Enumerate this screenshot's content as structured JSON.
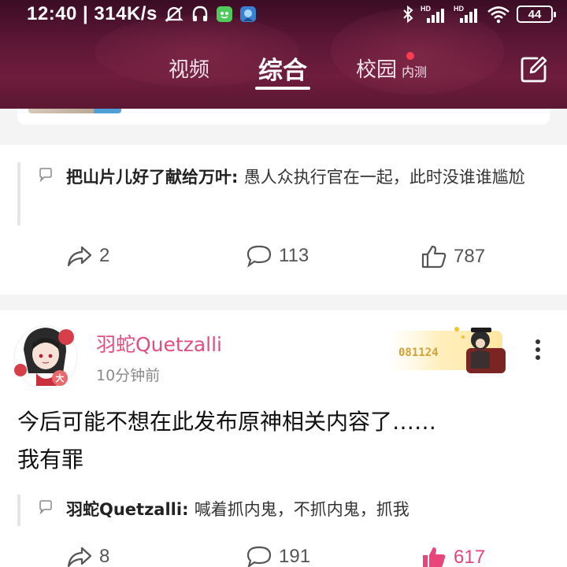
{
  "status_bar": {
    "time_speed": "12:40 | 314K/s",
    "battery": "44",
    "hd_label": "HD"
  },
  "nav": {
    "tabs": [
      "视频",
      "综合",
      "校园"
    ],
    "active_tab": "综合",
    "campus_badge": "内测"
  },
  "posts": [
    {
      "top_comment": {
        "author": "把山片儿好了献给万叶",
        "text": "愚人众执行官在一起，此时没谁谁尴尬"
      },
      "actions": {
        "shares": "2",
        "comments": "113",
        "likes": "787",
        "liked": false
      }
    },
    {
      "username": "羽蛇Quetzalli",
      "time": "10分钟前",
      "badge_number": "081124",
      "avatar_badge": "大",
      "body_line1": "今后可能不想在此发布原神相关内容了……",
      "body_line2": "我有罪",
      "top_comment": {
        "author": "羽蛇Quetzalli",
        "text": "喊着抓内鬼，不抓内鬼，抓我"
      },
      "actions": {
        "shares": "8",
        "comments": "191",
        "likes": "617",
        "liked": true
      }
    }
  ],
  "colors": {
    "header_bg": "#5a1634",
    "username": "#e34e7f",
    "liked": "#e8457a",
    "unread_dot": "#ff3b4f"
  },
  "icons": [
    "mute-icon",
    "headphones-icon",
    "app-icon",
    "bluetooth-icon",
    "signal-icon",
    "wifi-icon",
    "battery-icon",
    "edit-icon",
    "share-icon",
    "comment-icon",
    "like-icon",
    "more-icon"
  ]
}
